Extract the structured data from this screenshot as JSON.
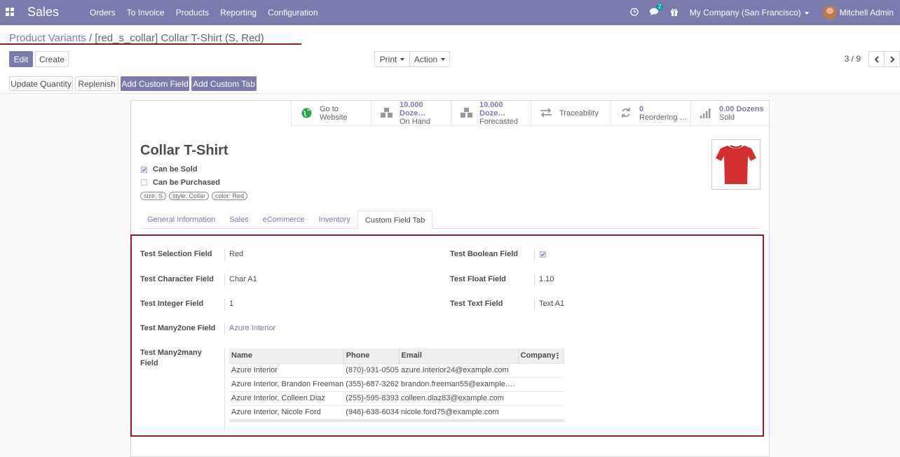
{
  "navbar": {
    "app_name": "Sales",
    "menu": [
      "Orders",
      "To Invoice",
      "Products",
      "Reporting",
      "Configuration"
    ],
    "messages_count": "2",
    "company": "My Company (San Francisco)",
    "user": "Mitchell Admin"
  },
  "breadcrumb": {
    "parent": "Product Variants",
    "separator": "/",
    "current": "[red_s_collar] Collar T-Shirt (S, Red)"
  },
  "toolbar": {
    "edit": "Edit",
    "create": "Create",
    "print": "Print",
    "action": "Action",
    "pager": "3 / 9",
    "update_quantity": "Update Quantity",
    "replenish": "Replenish",
    "add_custom_field": "Add Custom Field",
    "add_custom_tab": "Add Custom Tab"
  },
  "stat_buttons": [
    {
      "icon": "globe-icon",
      "line1": "Go to",
      "line2": "Website"
    },
    {
      "icon": "cubes-icon",
      "line1": "10.000 Doze…",
      "line2": "On Hand"
    },
    {
      "icon": "cubes-icon",
      "line1": "10.000 Doze…",
      "line2": "Forecasted"
    },
    {
      "icon": "arrows-icon",
      "line1": "Traceability",
      "line2": ""
    },
    {
      "icon": "refresh-icon",
      "line1": "0",
      "line2": "Reordering …"
    },
    {
      "icon": "signal-icon",
      "line1": "0.00 Dozens",
      "line2": "Sold"
    }
  ],
  "product": {
    "name": "Collar T-Shirt",
    "can_be_sold": "Can be Sold",
    "can_be_purchased": "Can be Purchased",
    "tags": [
      "size: S",
      "style: Collar",
      "color: Red"
    ]
  },
  "tabs": [
    "General Information",
    "Sales",
    "eCommerce",
    "Inventory",
    "Custom Field Tab"
  ],
  "fields": {
    "selection_label": "Test Selection Field",
    "selection_value": "Red",
    "boolean_label": "Test Boolean Field",
    "char_label": "Test Character Field",
    "char_value": "Char A1",
    "float_label": "Test Float Field",
    "float_value": "1.10",
    "integer_label": "Test Integer Field",
    "integer_value": "1",
    "text_label": "Test Text Field",
    "text_value": "Text A1",
    "many2one_label": "Test Many2one Field",
    "many2one_value": "Azure Interior",
    "many2many_label_1": "Test Many2many",
    "many2many_label_2": "Field"
  },
  "m2m_table": {
    "columns": [
      "Name",
      "Phone",
      "Email",
      "Company"
    ],
    "rows": [
      [
        "Azure Interior",
        "(870)-931-0505",
        "azure.Interior24@example.com",
        ""
      ],
      [
        "Azure Interior, Brandon Freeman",
        "(355)-687-3262",
        "brandon.freeman55@example.c…",
        ""
      ],
      [
        "Azure Interior, Colleen Diaz",
        "(255)-595-8393",
        "colleen.diaz83@example.com",
        ""
      ],
      [
        "Azure Interior, Nicole Ford",
        "(946)-638-6034",
        "nicole.ford75@example.com",
        ""
      ]
    ]
  },
  "colors": {
    "brand": "#7c7bad",
    "highlight": "#8a1c2b",
    "shirt": "#d32f2f"
  }
}
